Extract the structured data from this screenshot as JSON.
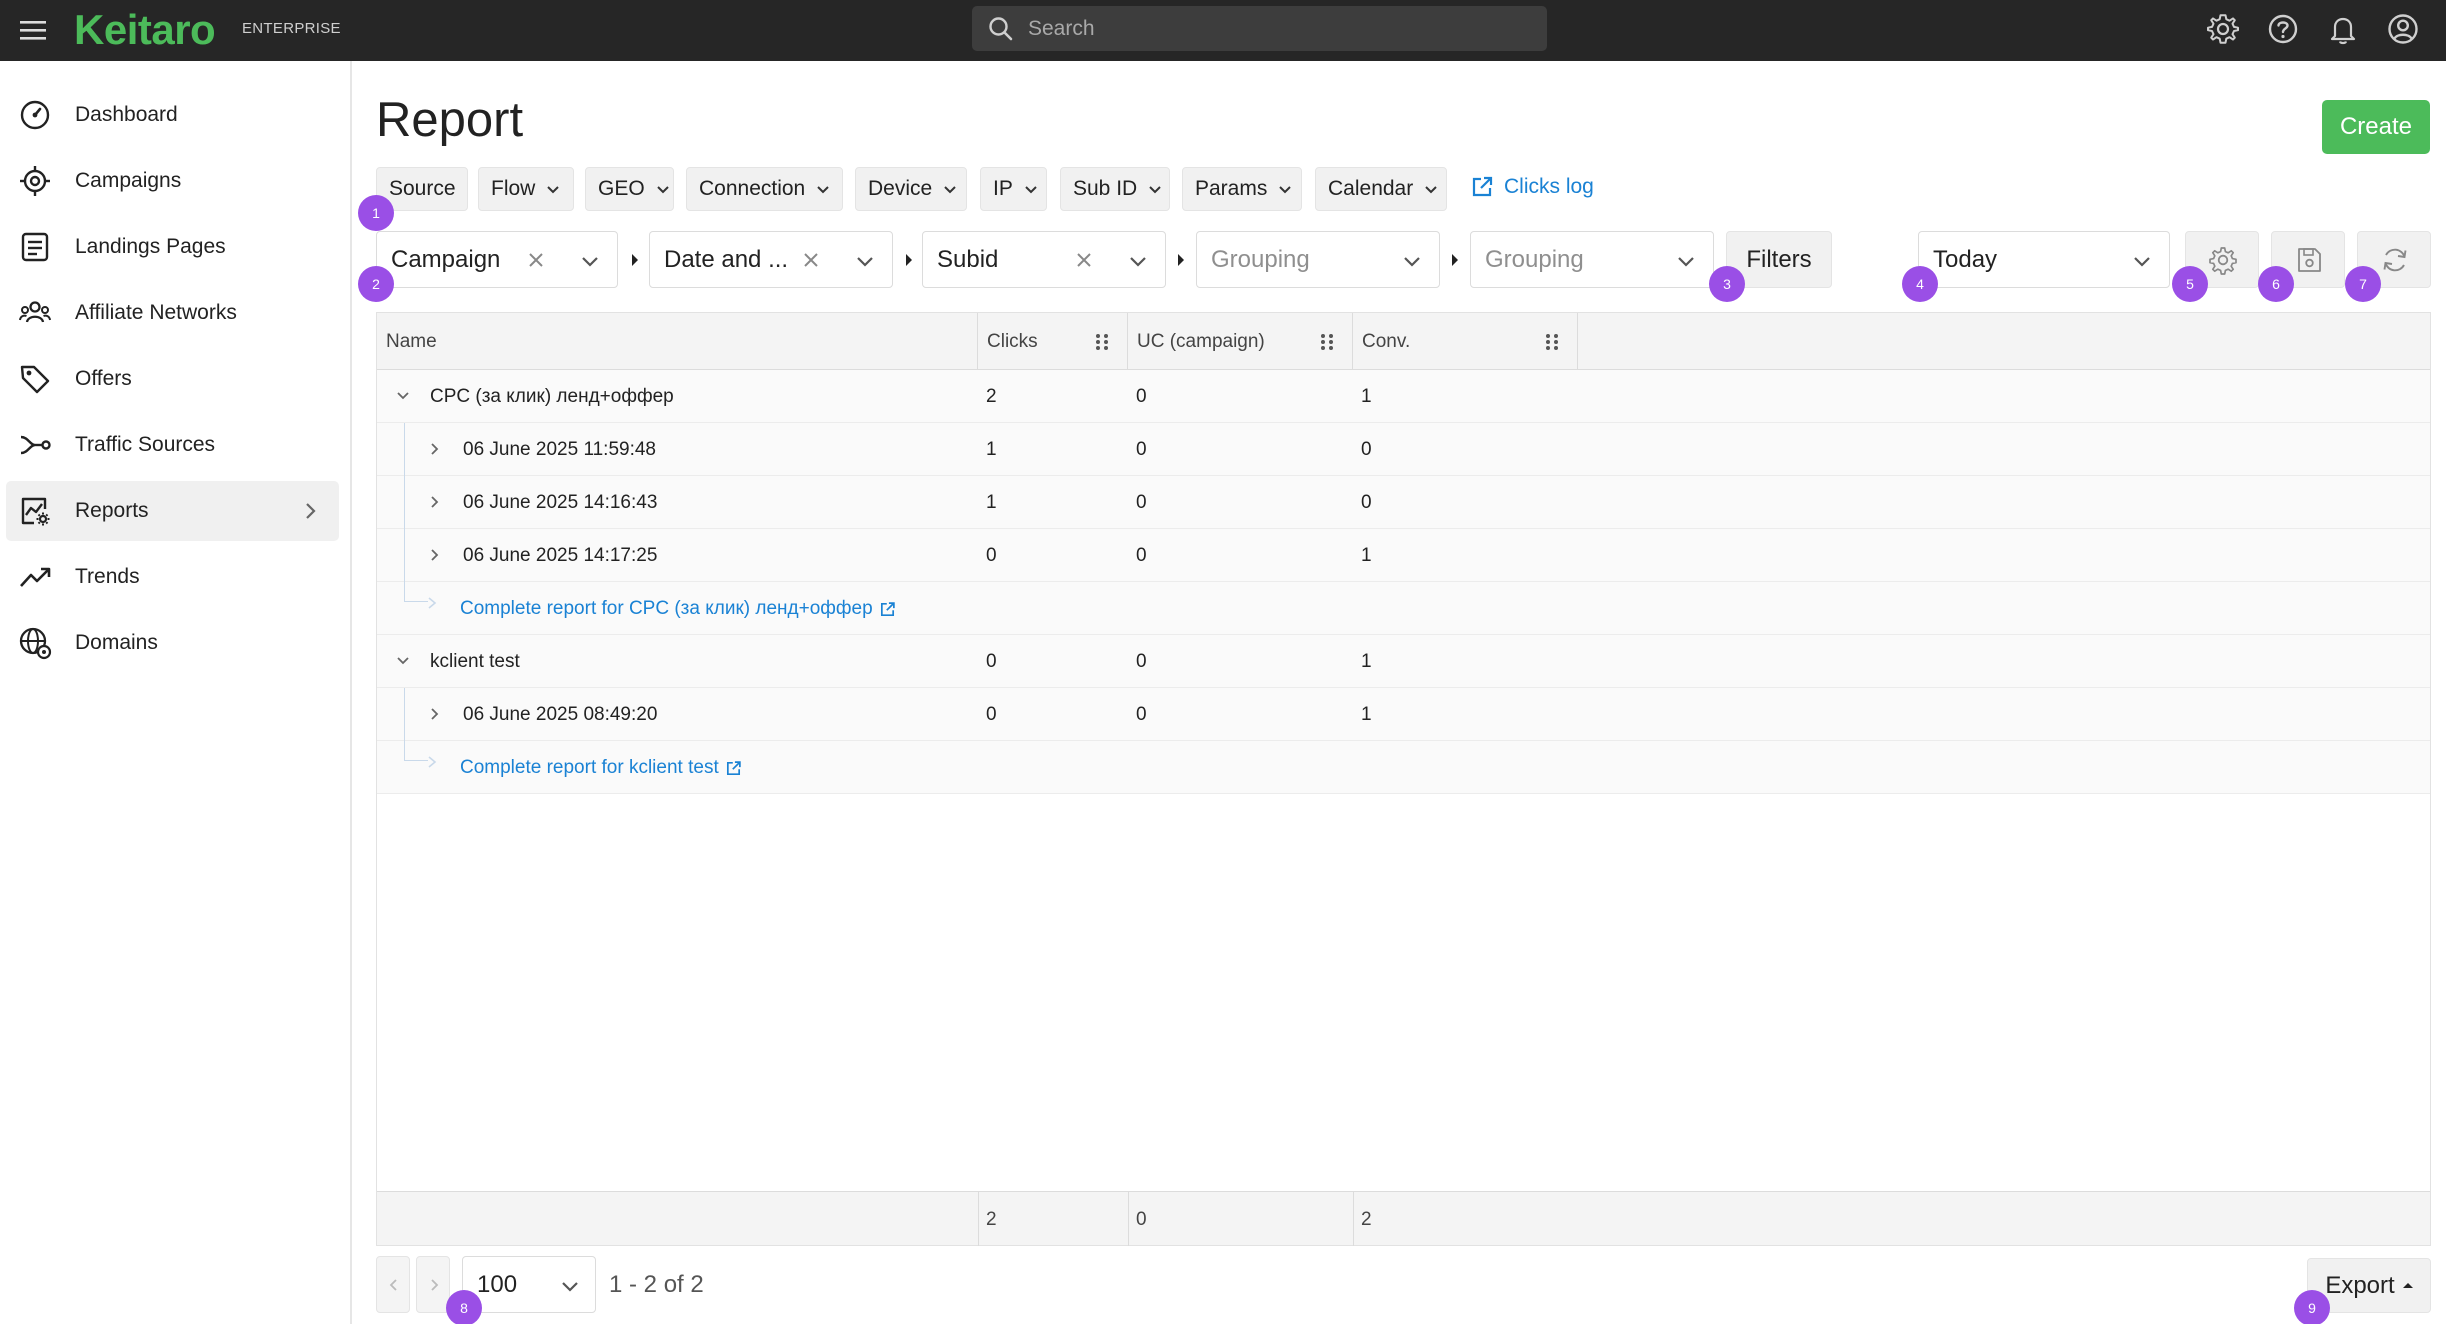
{
  "app": {
    "brand": "Keitaro",
    "edition": "ENTERPRISE",
    "search_placeholder": "Search"
  },
  "sidebar": {
    "items": [
      {
        "label": "Dashboard",
        "icon": "dashboard-icon"
      },
      {
        "label": "Campaigns",
        "icon": "campaigns-icon"
      },
      {
        "label": "Landings Pages",
        "icon": "landings-icon"
      },
      {
        "label": "Affiliate Networks",
        "icon": "affiliate-networks-icon"
      },
      {
        "label": "Offers",
        "icon": "offers-icon"
      },
      {
        "label": "Traffic Sources",
        "icon": "traffic-sources-icon"
      },
      {
        "label": "Reports",
        "icon": "reports-icon",
        "active": true
      },
      {
        "label": "Trends",
        "icon": "trends-icon"
      },
      {
        "label": "Domains",
        "icon": "domains-icon"
      }
    ]
  },
  "page": {
    "title": "Report",
    "create_label": "Create"
  },
  "quick_groups": [
    "Source",
    "Flow",
    "GEO",
    "Connection",
    "Device",
    "IP",
    "Sub ID",
    "Params",
    "Calendar"
  ],
  "clicks_log_label": "Clicks log",
  "groupings": {
    "g1": "Campaign",
    "g2": "Date and ...",
    "g3": "Subid",
    "g4_placeholder": "Grouping",
    "g5_placeholder": "Grouping"
  },
  "filters_label": "Filters",
  "period": "Today",
  "badges": [
    "1",
    "2",
    "3",
    "4",
    "5",
    "6",
    "7",
    "8",
    "9"
  ],
  "table": {
    "columns": [
      "Name",
      "Clicks",
      "UC (campaign)",
      "Conv."
    ],
    "groups": [
      {
        "name": "CPC (за клик) ленд+оффер",
        "clicks": "2",
        "uc": "0",
        "conv": "1",
        "children": [
          {
            "name": "06 June 2025 11:59:48",
            "clicks": "1",
            "uc": "0",
            "conv": "0"
          },
          {
            "name": "06 June 2025 14:16:43",
            "clicks": "1",
            "uc": "0",
            "conv": "0"
          },
          {
            "name": "06 June 2025 14:17:25",
            "clicks": "0",
            "uc": "0",
            "conv": "1"
          }
        ],
        "link": "Complete report for CPC (за клик) ленд+оффер"
      },
      {
        "name": "kclient test",
        "clicks": "0",
        "uc": "0",
        "conv": "1",
        "children": [
          {
            "name": "06 June 2025 08:49:20",
            "clicks": "0",
            "uc": "0",
            "conv": "1"
          }
        ],
        "link": "Complete report for kclient test"
      }
    ],
    "totals": {
      "clicks": "2",
      "uc": "0",
      "conv": "2"
    }
  },
  "pagination": {
    "per_page": "100",
    "info": "1 - 2 of 2"
  },
  "export_label": "Export",
  "colors": {
    "brand_green": "#4cbb5a",
    "link_blue": "#1a82d4",
    "badge_purple": "#9a4fe6",
    "topbar": "#262626"
  }
}
